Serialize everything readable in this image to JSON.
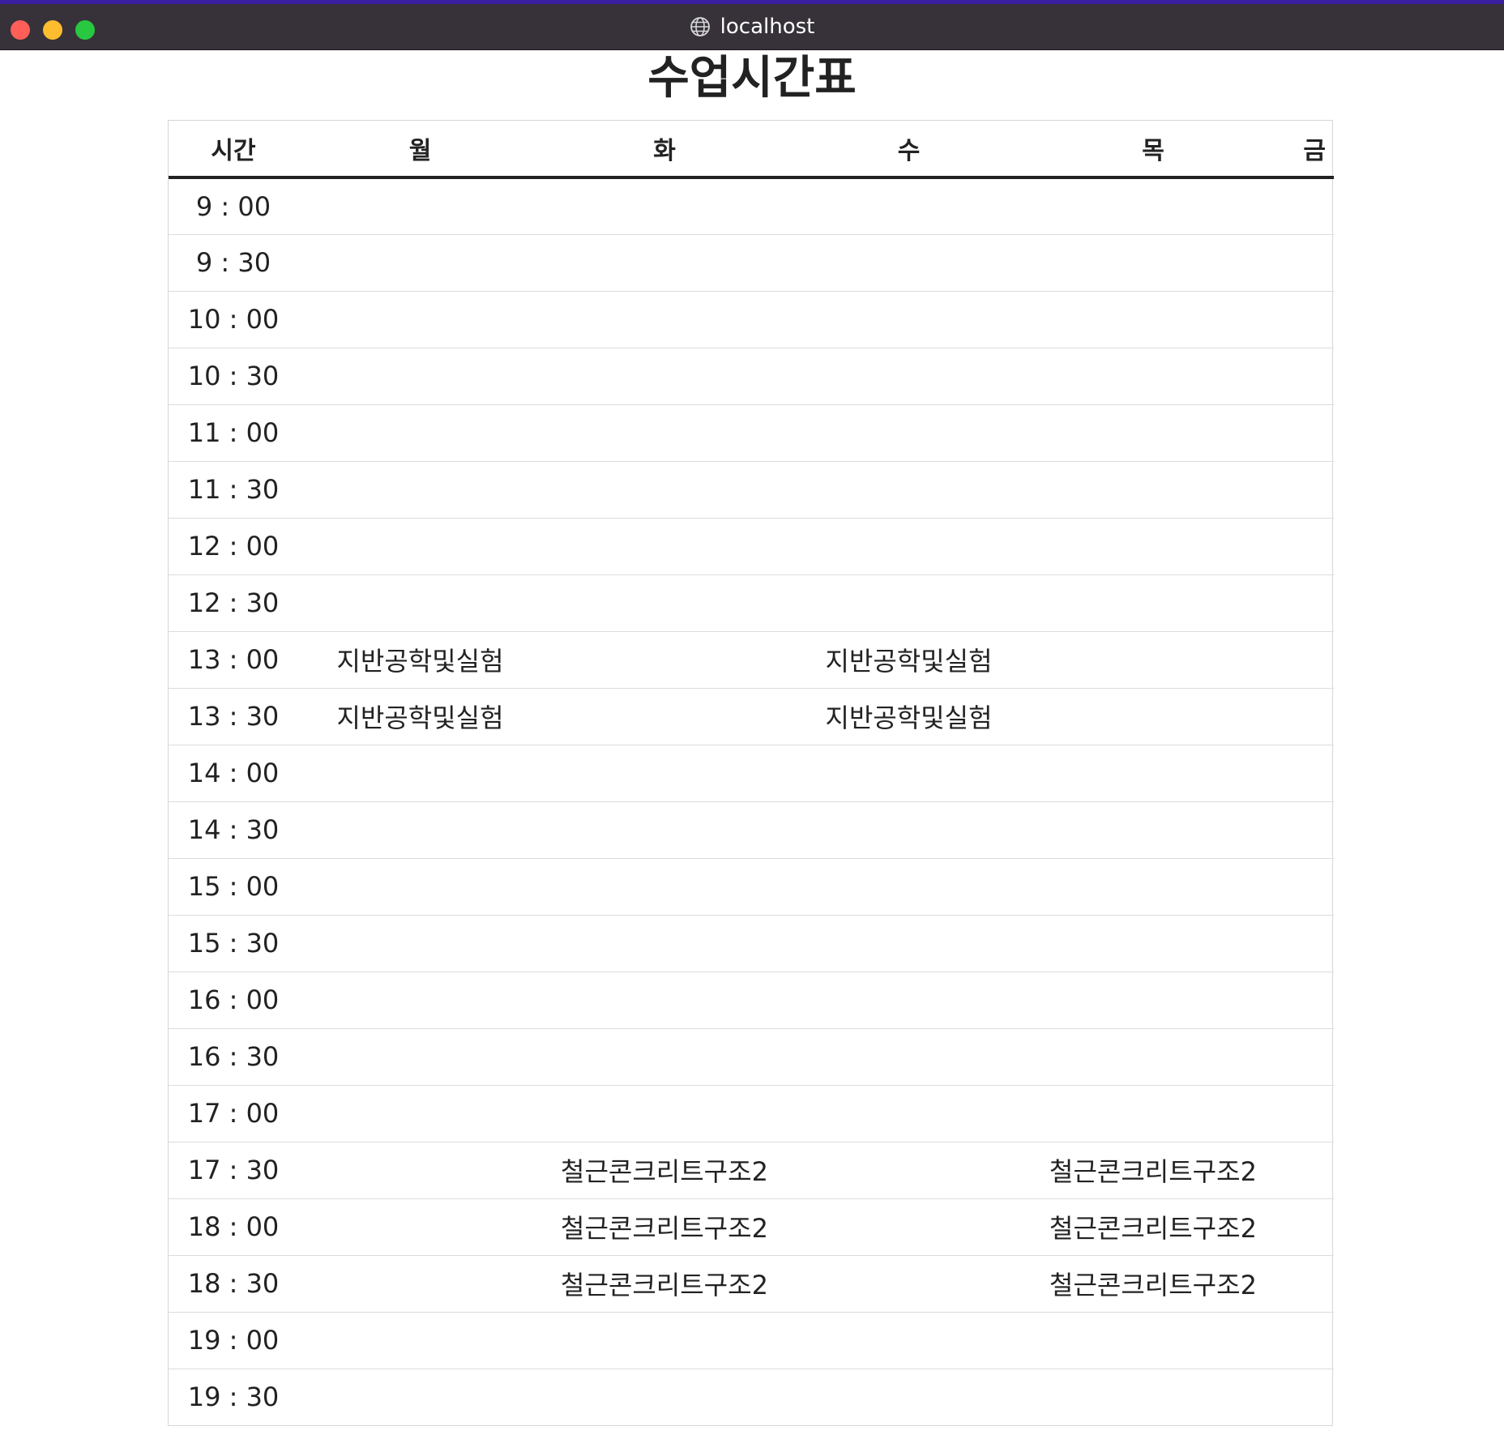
{
  "browser": {
    "address": "localhost",
    "icons": {
      "site": "globe-icon"
    },
    "colors": {
      "titlebar": "#37313a",
      "close": "#ff5f57",
      "minimize": "#febc2e",
      "maximize": "#28c840"
    }
  },
  "page": {
    "title": "수업시간표"
  },
  "timetable": {
    "headers": [
      "시간",
      "월",
      "화",
      "수",
      "목",
      "금"
    ],
    "rows": [
      {
        "time": "9 : 00",
        "cells": [
          "",
          "",
          "",
          "",
          ""
        ]
      },
      {
        "time": "9 : 30",
        "cells": [
          "",
          "",
          "",
          "",
          ""
        ]
      },
      {
        "time": "10 : 00",
        "cells": [
          "",
          "",
          "",
          "",
          ""
        ]
      },
      {
        "time": "10 : 30",
        "cells": [
          "",
          "",
          "",
          "",
          ""
        ]
      },
      {
        "time": "11 : 00",
        "cells": [
          "",
          "",
          "",
          "",
          ""
        ]
      },
      {
        "time": "11 : 30",
        "cells": [
          "",
          "",
          "",
          "",
          ""
        ]
      },
      {
        "time": "12 : 00",
        "cells": [
          "",
          "",
          "",
          "",
          ""
        ]
      },
      {
        "time": "12 : 30",
        "cells": [
          "",
          "",
          "",
          "",
          ""
        ]
      },
      {
        "time": "13 : 00",
        "cells": [
          "지반공학및실험",
          "",
          "지반공학및실험",
          "",
          ""
        ]
      },
      {
        "time": "13 : 30",
        "cells": [
          "지반공학및실험",
          "",
          "지반공학및실험",
          "",
          ""
        ]
      },
      {
        "time": "14 : 00",
        "cells": [
          "",
          "",
          "",
          "",
          ""
        ]
      },
      {
        "time": "14 : 30",
        "cells": [
          "",
          "",
          "",
          "",
          ""
        ]
      },
      {
        "time": "15 : 00",
        "cells": [
          "",
          "",
          "",
          "",
          ""
        ]
      },
      {
        "time": "15 : 30",
        "cells": [
          "",
          "",
          "",
          "",
          ""
        ]
      },
      {
        "time": "16 : 00",
        "cells": [
          "",
          "",
          "",
          "",
          ""
        ]
      },
      {
        "time": "16 : 30",
        "cells": [
          "",
          "",
          "",
          "",
          ""
        ]
      },
      {
        "time": "17 : 00",
        "cells": [
          "",
          "",
          "",
          "",
          ""
        ]
      },
      {
        "time": "17 : 30",
        "cells": [
          "",
          "철근콘크리트구조2",
          "",
          "철근콘크리트구조2",
          ""
        ]
      },
      {
        "time": "18 : 00",
        "cells": [
          "",
          "철근콘크리트구조2",
          "",
          "철근콘크리트구조2",
          ""
        ]
      },
      {
        "time": "18 : 30",
        "cells": [
          "",
          "철근콘크리트구조2",
          "",
          "철근콘크리트구조2",
          ""
        ]
      },
      {
        "time": "19 : 00",
        "cells": [
          "",
          "",
          "",
          "",
          ""
        ]
      },
      {
        "time": "19 : 30",
        "cells": [
          "",
          "",
          "",
          "",
          ""
        ]
      }
    ]
  }
}
